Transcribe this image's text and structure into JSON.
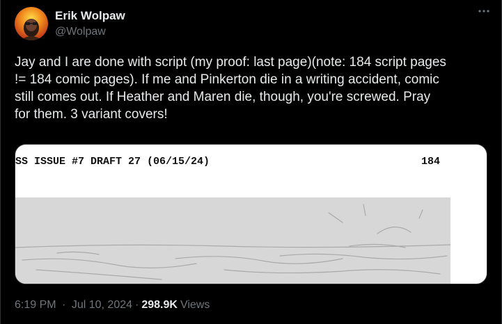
{
  "user": {
    "display_name": "Erik Wolpaw",
    "handle": "@Wolpaw"
  },
  "tweet": {
    "text": "Jay and I are done with script (my proof: last page)(note: 184 script pages\n!= 184 comic pages). If me and Pinkerton die in a writing accident, comic\nstill comes out. If Heather and Maren die, though, you're screwed. Pray\nfor them. 3 variant covers!",
    "time": "6:19 PM",
    "date": "Jul 10, 2024",
    "separator": "·",
    "views_count": "298.9K",
    "views_label": "Views"
  },
  "media": {
    "script_header_left": "SS ISSUE #7 DRAFT 27 (06/15/24)",
    "script_page_number": "184"
  },
  "icons": {
    "more": "more-horizontal-icon"
  },
  "colors": {
    "background": "#000000",
    "text": "#e7e9ea",
    "secondary": "#71767b",
    "border": "#2f3336"
  }
}
